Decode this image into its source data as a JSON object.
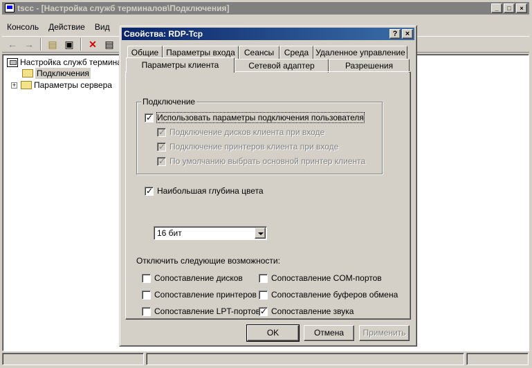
{
  "main_window": {
    "title": "tscc - [Настройка служб терминалов\\Подключения]",
    "controls": {
      "minimize": "_",
      "maximize": "□",
      "close": "×"
    }
  },
  "menu": {
    "items": [
      {
        "label": "Консоль"
      },
      {
        "label": "Действие"
      },
      {
        "label": "Вид"
      }
    ]
  },
  "toolbar": {
    "icons": [
      "back-icon",
      "forward-icon",
      "up-folder-icon",
      "show-tree-icon",
      "delete-icon",
      "properties-icon"
    ]
  },
  "tree": {
    "root": "Настройка служб терминал",
    "connections": "Подключения",
    "server_settings": "Параметры сервера",
    "expand_glyph": "+"
  },
  "dialog": {
    "title": "Свойства: RDP-Tcp",
    "help_btn": "?",
    "close_btn": "×",
    "tabs_row1": [
      "Общие",
      "Параметры входа",
      "Сеансы",
      "Среда",
      "Удаленное управление"
    ],
    "tabs_row2": [
      "Параметры клиента",
      "Сетевой адаптер",
      "Разрешения"
    ],
    "active_tab": "Параметры клиента",
    "group_connection": {
      "legend": "Подключение",
      "use_user_settings": {
        "label": "Использовать параметры подключения пользователя",
        "checked": true
      },
      "connect_drives": {
        "label": "Подключение дисков клиента при входе",
        "checked": true,
        "disabled": true
      },
      "connect_printers": {
        "label": "Подключение принтеров клиента при входе",
        "checked": true,
        "disabled": true
      },
      "default_printer": {
        "label": "По умолчанию выбрать основной принтер клиента",
        "checked": true,
        "disabled": true
      }
    },
    "color_depth": {
      "label": "Наибольшая глубина цвета",
      "checked": true,
      "value": "16 бит"
    },
    "disable_section": {
      "heading": "Отключить следующие возможности:",
      "drive_mapping": {
        "label": "Сопоставление дисков",
        "checked": false
      },
      "printer_mapping": {
        "label": "Сопоставление принтеров",
        "checked": false
      },
      "lpt_mapping": {
        "label": "Сопоставление LPT-портов",
        "checked": false
      },
      "com_mapping": {
        "label": "Сопоставление COM-портов",
        "checked": false
      },
      "clipboard_mapping": {
        "label": "Сопоставление буферов обмена",
        "checked": false
      },
      "audio_mapping": {
        "label": "Сопоставление звука",
        "checked": true
      }
    },
    "buttons": {
      "ok": "OK",
      "cancel": "Отмена",
      "apply": "Применить"
    }
  }
}
